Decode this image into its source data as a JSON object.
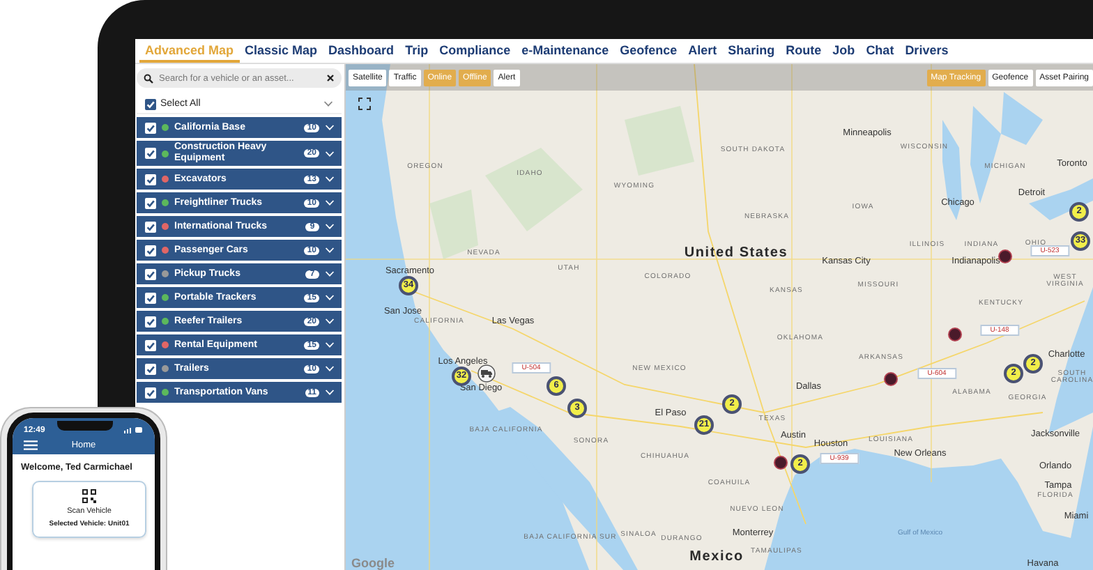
{
  "nav_tabs": [
    {
      "label": "Advanced Map",
      "selected": true
    },
    {
      "label": "Classic Map",
      "selected": false
    },
    {
      "label": "Dashboard",
      "selected": false
    },
    {
      "label": "Trip",
      "selected": false
    },
    {
      "label": "Compliance",
      "selected": false
    },
    {
      "label": "e-Maintenance",
      "selected": false
    },
    {
      "label": "Geofence",
      "selected": false
    },
    {
      "label": "Alert",
      "selected": false
    },
    {
      "label": "Sharing",
      "selected": false
    },
    {
      "label": "Route",
      "selected": false
    },
    {
      "label": "Job",
      "selected": false
    },
    {
      "label": "Chat",
      "selected": false
    },
    {
      "label": "Drivers",
      "selected": false
    }
  ],
  "sidebar": {
    "search": {
      "placeholder": "Search for a vehicle or an asset..."
    },
    "select_all": {
      "label": "Select All",
      "checked": true
    },
    "groups": [
      {
        "name": "California Base",
        "count": "10",
        "color": "#5cb85c",
        "checked": true
      },
      {
        "name": "Construction Heavy Equipment",
        "count": "20",
        "color": "#5cb85c",
        "checked": true
      },
      {
        "name": "Excavators",
        "count": "13",
        "color": "#e06666",
        "checked": true
      },
      {
        "name": "Freightliner Trucks",
        "count": "10",
        "color": "#5cb85c",
        "checked": true
      },
      {
        "name": "International Trucks",
        "count": "9",
        "color": "#e06666",
        "checked": true
      },
      {
        "name": "Passenger Cars",
        "count": "10",
        "color": "#e06666",
        "checked": true
      },
      {
        "name": "Pickup Trucks",
        "count": "7",
        "color": "#999999",
        "checked": true
      },
      {
        "name": "Portable Trackers",
        "count": "15",
        "color": "#5cb85c",
        "checked": true
      },
      {
        "name": "Reefer Trailers",
        "count": "20",
        "color": "#5cb85c",
        "checked": true
      },
      {
        "name": "Rental Equipment",
        "count": "15",
        "color": "#e06666",
        "checked": true
      },
      {
        "name": "Trailers",
        "count": "10",
        "color": "#999999",
        "checked": true
      },
      {
        "name": "Transportation Vans",
        "count": "11",
        "color": "#5cb85c",
        "checked": true
      }
    ]
  },
  "map": {
    "toolbar_left": [
      {
        "label": "Satellite",
        "active": false
      },
      {
        "label": "Traffic",
        "active": false
      },
      {
        "label": "Online",
        "active": true
      },
      {
        "label": "Offline",
        "active": true
      },
      {
        "label": "Alert",
        "active": false
      }
    ],
    "toolbar_right": [
      {
        "label": "Map Tracking",
        "active": true
      },
      {
        "label": "Geofence",
        "active": false
      },
      {
        "label": "Asset Pairing",
        "active": false
      }
    ],
    "labels": [
      {
        "text": "Minneapolis",
        "kind": "city"
      },
      {
        "text": "WISCONSIN",
        "kind": "state"
      },
      {
        "text": "MICHIGAN",
        "kind": "state"
      },
      {
        "text": "Toronto",
        "kind": "city"
      },
      {
        "text": "Detroit",
        "kind": "city"
      },
      {
        "text": "Chicago",
        "kind": "city"
      },
      {
        "text": "OREGON",
        "kind": "state"
      },
      {
        "text": "IDAHO",
        "kind": "state"
      },
      {
        "text": "WYOMING",
        "kind": "state"
      },
      {
        "text": "SOUTH DAKOTA",
        "kind": "state"
      },
      {
        "text": "NEBRASKA",
        "kind": "state"
      },
      {
        "text": "IOWA",
        "kind": "state"
      },
      {
        "text": "NEVADA",
        "kind": "state"
      },
      {
        "text": "UTAH",
        "kind": "state"
      },
      {
        "text": "COLORADO",
        "kind": "state"
      },
      {
        "text": "United States",
        "kind": "country"
      },
      {
        "text": "KANSAS",
        "kind": "state"
      },
      {
        "text": "Kansas City",
        "kind": "city"
      },
      {
        "text": "MISSOURI",
        "kind": "state"
      },
      {
        "text": "ILLINOIS",
        "kind": "state"
      },
      {
        "text": "INDIANA",
        "kind": "state"
      },
      {
        "text": "OHIO",
        "kind": "state"
      },
      {
        "text": "Indianapolis",
        "kind": "city"
      },
      {
        "text": "WEST VIRGINIA",
        "kind": "state"
      },
      {
        "text": "KENTUCKY",
        "kind": "state"
      },
      {
        "text": "Sacramento",
        "kind": "city"
      },
      {
        "text": "San Jose",
        "kind": "city"
      },
      {
        "text": "CALIFORNIA",
        "kind": "state"
      },
      {
        "text": "Las Vegas",
        "kind": "city"
      },
      {
        "text": "Los Angeles",
        "kind": "city"
      },
      {
        "text": "San Diego",
        "kind": "city"
      },
      {
        "text": "NEW MEXICO",
        "kind": "state"
      },
      {
        "text": "OKLAHOMA",
        "kind": "state"
      },
      {
        "text": "ARKANSAS",
        "kind": "state"
      },
      {
        "text": "Dallas",
        "kind": "city"
      },
      {
        "text": "TEXAS",
        "kind": "state"
      },
      {
        "text": "El Paso",
        "kind": "city"
      },
      {
        "text": "Austin",
        "kind": "city"
      },
      {
        "text": "Houston",
        "kind": "city"
      },
      {
        "text": "LOUISIANA",
        "kind": "state"
      },
      {
        "text": "New Orleans",
        "kind": "city"
      },
      {
        "text": "ALABAMA",
        "kind": "state"
      },
      {
        "text": "GEORGIA",
        "kind": "state"
      },
      {
        "text": "Charlotte",
        "kind": "city"
      },
      {
        "text": "SOUTH CAROLINA",
        "kind": "state"
      },
      {
        "text": "Jacksonville",
        "kind": "city"
      },
      {
        "text": "Orlando",
        "kind": "city"
      },
      {
        "text": "Tampa",
        "kind": "city"
      },
      {
        "text": "FLORIDA",
        "kind": "state"
      },
      {
        "text": "Miami",
        "kind": "city"
      },
      {
        "text": "BAJA CALIFORNIA",
        "kind": "state"
      },
      {
        "text": "SONORA",
        "kind": "state"
      },
      {
        "text": "CHIHUAHUA",
        "kind": "state"
      },
      {
        "text": "COAHUILA",
        "kind": "state"
      },
      {
        "text": "NUEVO LEON",
        "kind": "state"
      },
      {
        "text": "SINALOA",
        "kind": "state"
      },
      {
        "text": "DURANGO",
        "kind": "state"
      },
      {
        "text": "Monterrey",
        "kind": "city"
      },
      {
        "text": "TAMAULIPAS",
        "kind": "state"
      },
      {
        "text": "Mexico",
        "kind": "country"
      },
      {
        "text": "BAJA CALIFORNIA SUR",
        "kind": "state"
      },
      {
        "text": "Gulf of Mexico",
        "kind": "water"
      },
      {
        "text": "Havana",
        "kind": "city"
      }
    ],
    "markers": [
      {
        "kind": "cluster",
        "count": "34"
      },
      {
        "kind": "cluster",
        "count": "32"
      },
      {
        "kind": "cluster",
        "count": "6"
      },
      {
        "kind": "cluster",
        "count": "3"
      },
      {
        "kind": "cluster",
        "count": "2"
      },
      {
        "kind": "cluster",
        "count": "21"
      },
      {
        "kind": "cluster",
        "count": "2"
      },
      {
        "kind": "cluster",
        "count": "2"
      },
      {
        "kind": "cluster",
        "count": "2"
      },
      {
        "kind": "cluster",
        "count": "2"
      },
      {
        "kind": "cluster",
        "count": "33"
      },
      {
        "kind": "truck",
        "tag": "U-504"
      },
      {
        "kind": "vehicle",
        "tag": "U-523"
      },
      {
        "kind": "vehicle",
        "tag": "U-148"
      },
      {
        "kind": "vehicle",
        "tag": "U-604"
      },
      {
        "kind": "vehicle",
        "tag": "U-939"
      }
    ],
    "attribution": "Google"
  },
  "phone": {
    "time": "12:49",
    "title": "Home",
    "welcome": "Welcome, Ted Carmichael",
    "card_title": "Scan Vehicle",
    "card_subtitle": "Selected Vehicle: Unit01"
  }
}
